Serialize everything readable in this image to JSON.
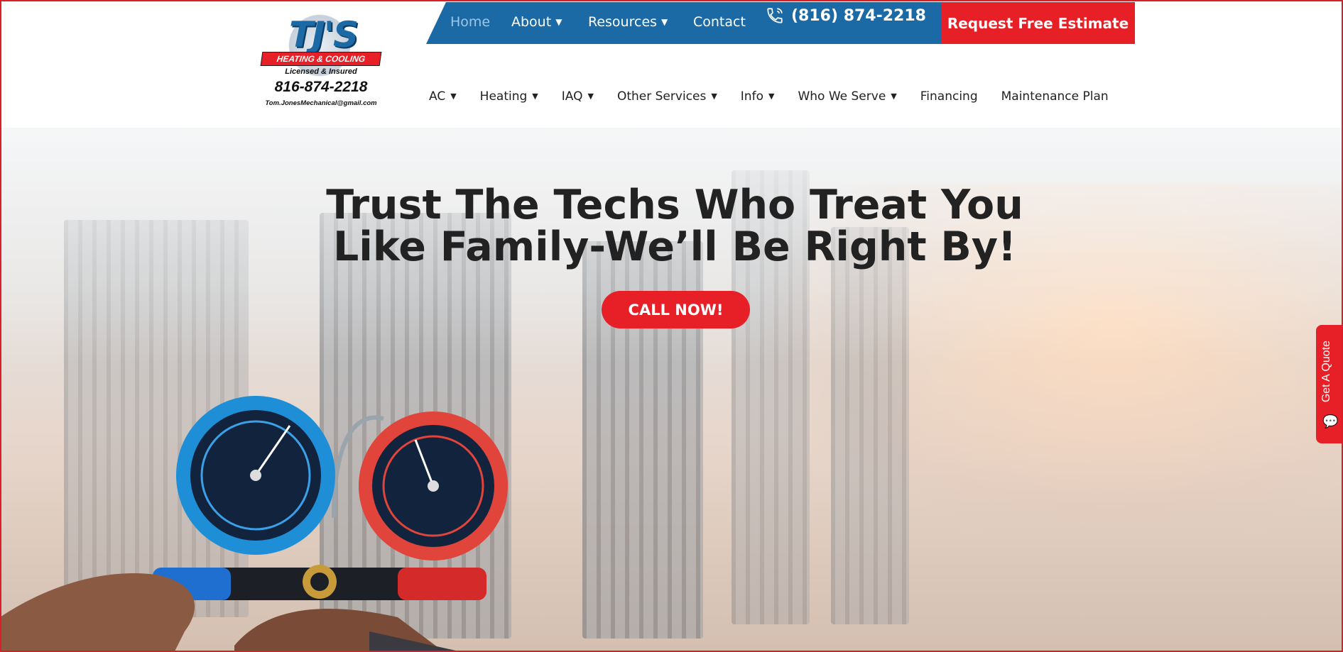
{
  "topbar": {
    "nav": [
      {
        "label": "Home",
        "active": true,
        "dropdown": false
      },
      {
        "label": "About",
        "active": false,
        "dropdown": true
      },
      {
        "label": "Resources",
        "active": false,
        "dropdown": true
      },
      {
        "label": "Contact",
        "active": false,
        "dropdown": false
      }
    ],
    "phone": "(816) 874-2218",
    "phone_icon": "phone-icon",
    "estimate_label": "Request Free Estimate"
  },
  "logo": {
    "brand": "TJ'S",
    "banner": "HEATING & COOLING",
    "licensed": "Licensed & Insured",
    "phone": "816-874-2218",
    "email": "Tom.JonesMechanical@gmail.com"
  },
  "main_nav": [
    {
      "label": "AC",
      "dropdown": true
    },
    {
      "label": "Heating",
      "dropdown": true
    },
    {
      "label": "IAQ",
      "dropdown": true
    },
    {
      "label": "Other Services",
      "dropdown": true
    },
    {
      "label": "Info",
      "dropdown": true
    },
    {
      "label": "Who We Serve",
      "dropdown": true
    },
    {
      "label": "Financing",
      "dropdown": false
    },
    {
      "label": "Maintenance Plan",
      "dropdown": false
    }
  ],
  "hero": {
    "headline_line1": "Trust The Techs Who Treat You",
    "headline_line2": "Like Family-We’ll Be Right By!",
    "cta_label": "CALL NOW!"
  },
  "quote_tab": {
    "label": "Get A Quote",
    "icon": "chat-bubble-icon"
  },
  "colors": {
    "brand_blue": "#1b6aa5",
    "brand_red": "#e62026",
    "text_dark": "#222222"
  }
}
